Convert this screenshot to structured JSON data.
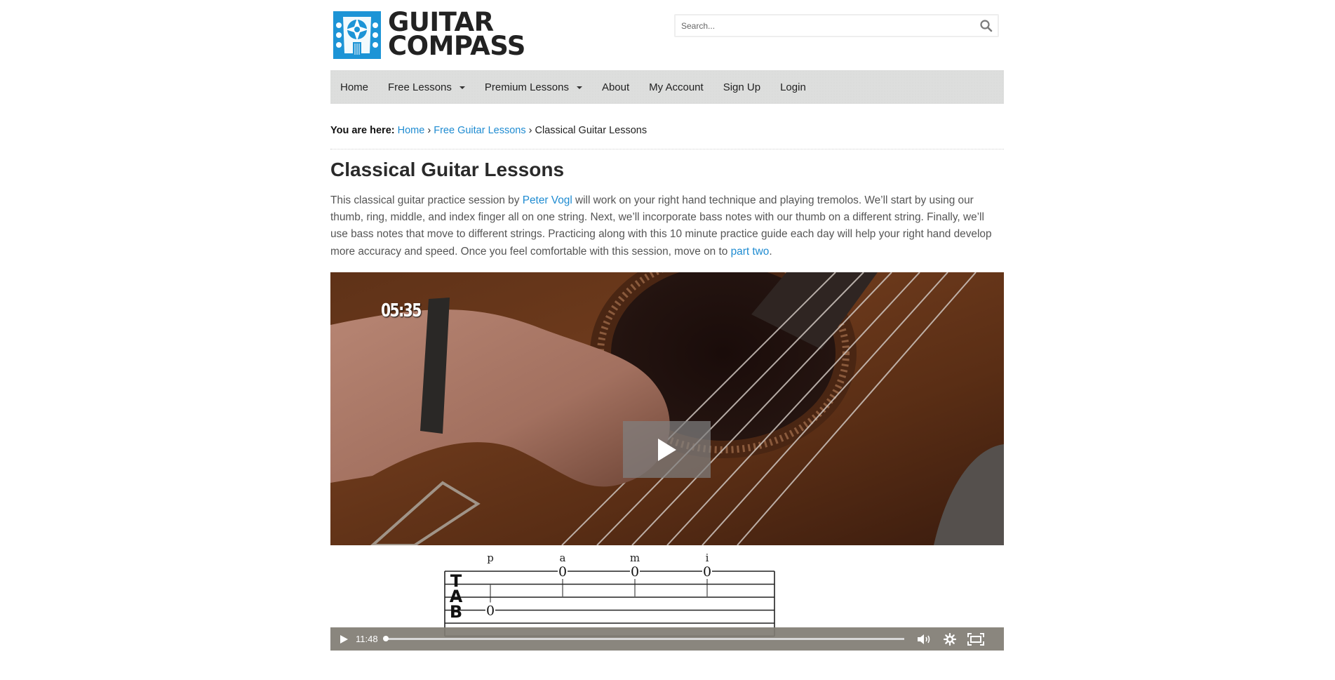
{
  "header": {
    "logo_line1": "GUITAR",
    "logo_line2": "COMPASS",
    "search_placeholder": "Search...",
    "brand_color": "#1d94d6"
  },
  "nav": {
    "items": [
      {
        "label": "Home",
        "dropdown": false
      },
      {
        "label": "Free Lessons",
        "dropdown": true
      },
      {
        "label": "Premium Lessons",
        "dropdown": true
      },
      {
        "label": "About",
        "dropdown": false
      },
      {
        "label": "My Account",
        "dropdown": false
      },
      {
        "label": "Sign Up",
        "dropdown": false
      },
      {
        "label": "Login",
        "dropdown": false
      }
    ]
  },
  "breadcrumb": {
    "prefix": "You are here:",
    "items": [
      "Home",
      "Free Guitar Lessons",
      "Classical Guitar Lessons"
    ],
    "separator": "›"
  },
  "page": {
    "title": "Classical Guitar Lessons",
    "intro_part1": "This classical guitar practice session by ",
    "author_link": "Peter Vogl",
    "intro_part2": " will work on your right hand technique and playing tremolos. We’ll start by using our thumb, ring, middle, and index finger all on one string. Next, we’ll incorporate bass notes with our thumb on a different string. Finally, we’ll use bass notes that move to different strings. Practicing along with this 10 minute practice guide each day will help your right hand develop more accuracy and speed. Once you feel comfortable with this session, move on to ",
    "next_link": "part two",
    "intro_end": ".",
    "link_color": "#1e8bd1"
  },
  "video": {
    "overlay_time": "05:35",
    "duration": "11:48",
    "progress_fraction": 0.0,
    "tab": {
      "finger_labels": [
        "p",
        "a",
        "m",
        "i"
      ],
      "clef": [
        "T",
        "A",
        "B"
      ],
      "notes": [
        {
          "finger": "p",
          "fret": "0",
          "string": 4
        },
        {
          "finger": "a",
          "fret": "0",
          "string": 1
        },
        {
          "finger": "m",
          "fret": "0",
          "string": 1
        },
        {
          "finger": "i",
          "fret": "0",
          "string": 1
        }
      ]
    },
    "controls": {
      "play": "play-icon",
      "volume": "volume-icon",
      "settings": "gear-icon",
      "fullscreen": "fullscreen-icon"
    }
  }
}
